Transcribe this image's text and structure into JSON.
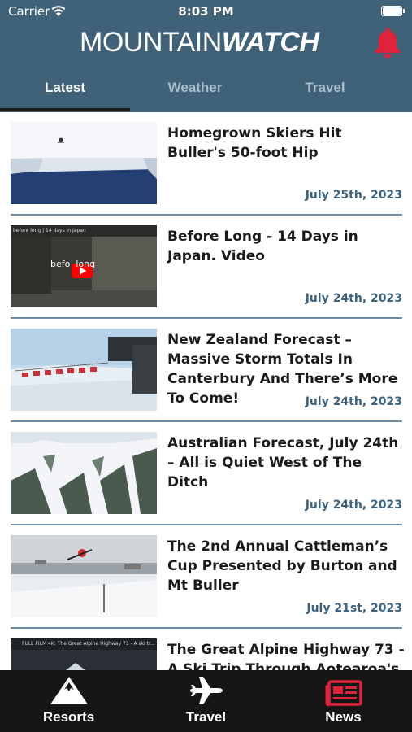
{
  "status_bar": {
    "carrier": "Carrier",
    "time": "8:03 PM"
  },
  "header": {
    "logo_part1": "MOUNTAIN",
    "logo_part2": "WATCH"
  },
  "tabs": [
    {
      "label": "Latest",
      "active": true
    },
    {
      "label": "Weather",
      "active": false
    },
    {
      "label": "Travel",
      "active": false
    }
  ],
  "articles": [
    {
      "title": "Homegrown Skiers Hit Buller's 50-foot Hip",
      "date": "July 25th, 2023"
    },
    {
      "title": "Before Long - 14 Days in Japan. Video",
      "date": "July 24th, 2023",
      "thumb_caption": "before long | 14 days in Japan",
      "thumb_overlay": "befo  long"
    },
    {
      "title": "New Zealand Forecast –  Massive Storm Totals In Canterbury And There’s More To Come!",
      "date": "July 24th, 2023"
    },
    {
      "title": "Australian Forecast, July 24th – All is Quiet West of The Ditch",
      "date": "July 24th, 2023"
    },
    {
      "title": "The 2nd Annual Cattleman’s Cup Presented by Burton and Mt Buller",
      "date": "July 21st, 2023"
    },
    {
      "title": "The Great Alpine Highway 73 - A Ski Trip Through Aotearoa's",
      "date": "",
      "thumb_caption": "FULL FILM 4K: The Great Alpine Highway 73 - A ski tr..."
    }
  ],
  "bottom_nav": [
    {
      "label": "Resorts",
      "icon": "mountain-icon",
      "color": "#ffffff"
    },
    {
      "label": "Travel",
      "icon": "airplane-icon",
      "color": "#ffffff"
    },
    {
      "label": "News",
      "icon": "newspaper-icon",
      "color": "#e0223a"
    }
  ],
  "colors": {
    "header_bg": "#3f6279",
    "accent_red": "#e0223a",
    "date_blue": "#3d6280",
    "tabbar_bg": "#161616"
  }
}
